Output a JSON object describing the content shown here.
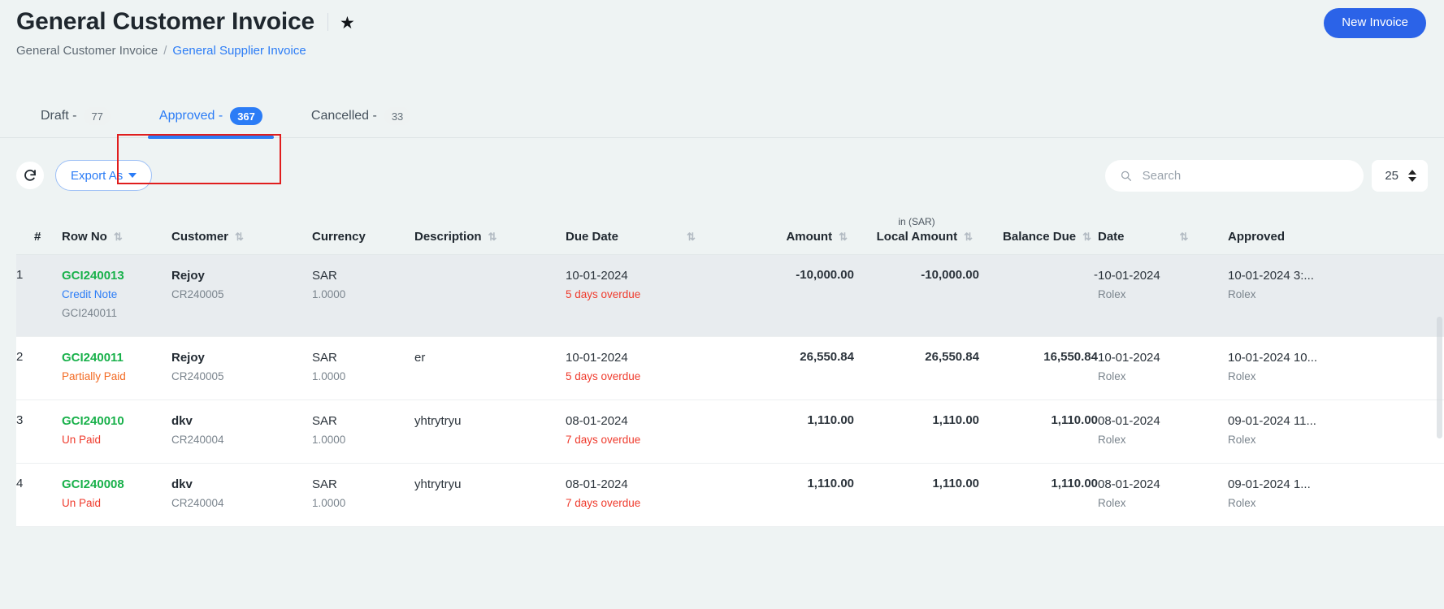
{
  "header": {
    "title": "General Customer Invoice",
    "star_icon": "star-icon",
    "new_invoice_label": "New Invoice",
    "accent_color": "#2b63e8"
  },
  "breadcrumb": {
    "current": "General Customer Invoice",
    "separator": "/",
    "link": "General Supplier Invoice",
    "link_color": "#2b7cf6"
  },
  "tabs": [
    {
      "label": "Draft -",
      "count": "77",
      "active": false
    },
    {
      "label": "Approved -",
      "count": "367",
      "active": true
    },
    {
      "label": "Cancelled -",
      "count": "33",
      "active": false
    }
  ],
  "toolbar": {
    "refresh_icon": "refresh-icon",
    "export_label": "Export As",
    "search_placeholder": "Search",
    "search_value": "",
    "search_icon": "search-icon",
    "page_size": "25"
  },
  "table": {
    "currency_note": "in (SAR)",
    "columns": [
      {
        "key": "index",
        "label": "#",
        "sortable": false,
        "align": "left"
      },
      {
        "key": "row_no",
        "label": "Row No",
        "sortable": true,
        "align": "left"
      },
      {
        "key": "customer",
        "label": "Customer",
        "sortable": true,
        "align": "left"
      },
      {
        "key": "currency",
        "label": "Currency",
        "sortable": false,
        "align": "left"
      },
      {
        "key": "description",
        "label": "Description",
        "sortable": true,
        "align": "left"
      },
      {
        "key": "due_date",
        "label": "Due Date",
        "sortable": true,
        "align": "left"
      },
      {
        "key": "amount",
        "label": "Amount",
        "sortable": true,
        "align": "right"
      },
      {
        "key": "local_amount",
        "label": "Local Amount",
        "sortable": true,
        "align": "right"
      },
      {
        "key": "balance_due",
        "label": "Balance Due",
        "sortable": true,
        "align": "right"
      },
      {
        "key": "date",
        "label": "Date",
        "sortable": true,
        "align": "left"
      },
      {
        "key": "approved",
        "label": "Approved",
        "sortable": false,
        "align": "left"
      }
    ],
    "rows": [
      {
        "index": "1",
        "row_no": "GCI240013",
        "status": "Credit Note",
        "status_kind": "credit-note",
        "ref": "GCI240011",
        "customer": "Rejoy",
        "customer_code": "CR240005",
        "currency": "SAR",
        "rate": "1.0000",
        "description": "",
        "due_date": "10-01-2024",
        "overdue": "5 days overdue",
        "amount": "-10,000.00",
        "local_amount": "-10,000.00",
        "balance_due": "-",
        "date": "10-01-2024",
        "date_user": "Rolex",
        "approved": "10-01-2024 3:...",
        "approved_user": "Rolex",
        "highlighted": true
      },
      {
        "index": "2",
        "row_no": "GCI240011",
        "status": "Partially Paid",
        "status_kind": "partially-paid",
        "ref": "",
        "customer": "Rejoy",
        "customer_code": "CR240005",
        "currency": "SAR",
        "rate": "1.0000",
        "description": "er",
        "due_date": "10-01-2024",
        "overdue": "5 days overdue",
        "amount": "26,550.84",
        "local_amount": "26,550.84",
        "balance_due": "16,550.84",
        "date": "10-01-2024",
        "date_user": "Rolex",
        "approved": "10-01-2024 10...",
        "approved_user": "Rolex",
        "highlighted": false
      },
      {
        "index": "3",
        "row_no": "GCI240010",
        "status": "Un Paid",
        "status_kind": "un-paid",
        "ref": "",
        "customer": "dkv",
        "customer_code": "CR240004",
        "currency": "SAR",
        "rate": "1.0000",
        "description": "yhtrytryu",
        "due_date": "08-01-2024",
        "overdue": "7 days overdue",
        "amount": "1,110.00",
        "local_amount": "1,110.00",
        "balance_due": "1,110.00",
        "date": "08-01-2024",
        "date_user": "Rolex",
        "approved": "09-01-2024 11...",
        "approved_user": "Rolex",
        "highlighted": false
      },
      {
        "index": "4",
        "row_no": "GCI240008",
        "status": "Un Paid",
        "status_kind": "un-paid",
        "ref": "",
        "customer": "dkv",
        "customer_code": "CR240004",
        "currency": "SAR",
        "rate": "1.0000",
        "description": "yhtrytryu",
        "due_date": "08-01-2024",
        "overdue": "7 days overdue",
        "amount": "1,110.00",
        "local_amount": "1,110.00",
        "balance_due": "1,110.00",
        "date": "08-01-2024",
        "date_user": "Rolex",
        "approved": "09-01-2024 1...",
        "approved_user": "Rolex",
        "highlighted": false
      }
    ]
  },
  "colors": {
    "green": "#19b14b",
    "red": "#ef3b2d",
    "orange": "#f36a22",
    "blue": "#2b7cf6",
    "page_bg": "#eef3f3"
  }
}
